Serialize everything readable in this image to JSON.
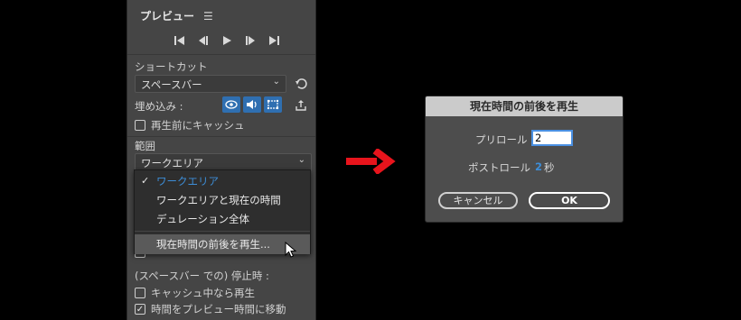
{
  "panel": {
    "title": "プレビュー",
    "menu_icon": "hamburger-icon",
    "transport": [
      "go-to-start-icon",
      "step-back-icon",
      "play-icon",
      "step-forward-icon",
      "go-to-end-icon"
    ],
    "shortcut_label": "ショートカット",
    "shortcut_value": "スペースバー",
    "embed_label": "埋め込み :",
    "cache_before_play": "再生前にキャッシュ",
    "range_label": "範囲",
    "range_value": "ワークエリア",
    "stop_label": "(スペースバー での) 停止時 :",
    "play_if_caching": "キャッシュ中なら再生",
    "move_time_to_preview": "時間をプレビュー時間に移動"
  },
  "menu": {
    "items": [
      {
        "label": "ワークエリア",
        "checked": true
      },
      {
        "label": "ワークエリアと現在の時間",
        "checked": false
      },
      {
        "label": "デュレーション全体",
        "checked": false
      },
      {
        "label": "現在時間の前後を再生...",
        "checked": false
      }
    ]
  },
  "dialog": {
    "title": "現在時間の前後を再生",
    "preroll_label": "プリロール",
    "preroll_value": "2",
    "postroll_label": "ポストロール",
    "postroll_value": "2",
    "postroll_unit": "秒",
    "cancel_label": "キャンセル",
    "ok_label": "OK"
  },
  "colors": {
    "accent_blue": "#3d8ed8",
    "arrow_red": "#e8141c",
    "panel_bg": "#454545",
    "dialog_bg": "#4d4d4d"
  }
}
